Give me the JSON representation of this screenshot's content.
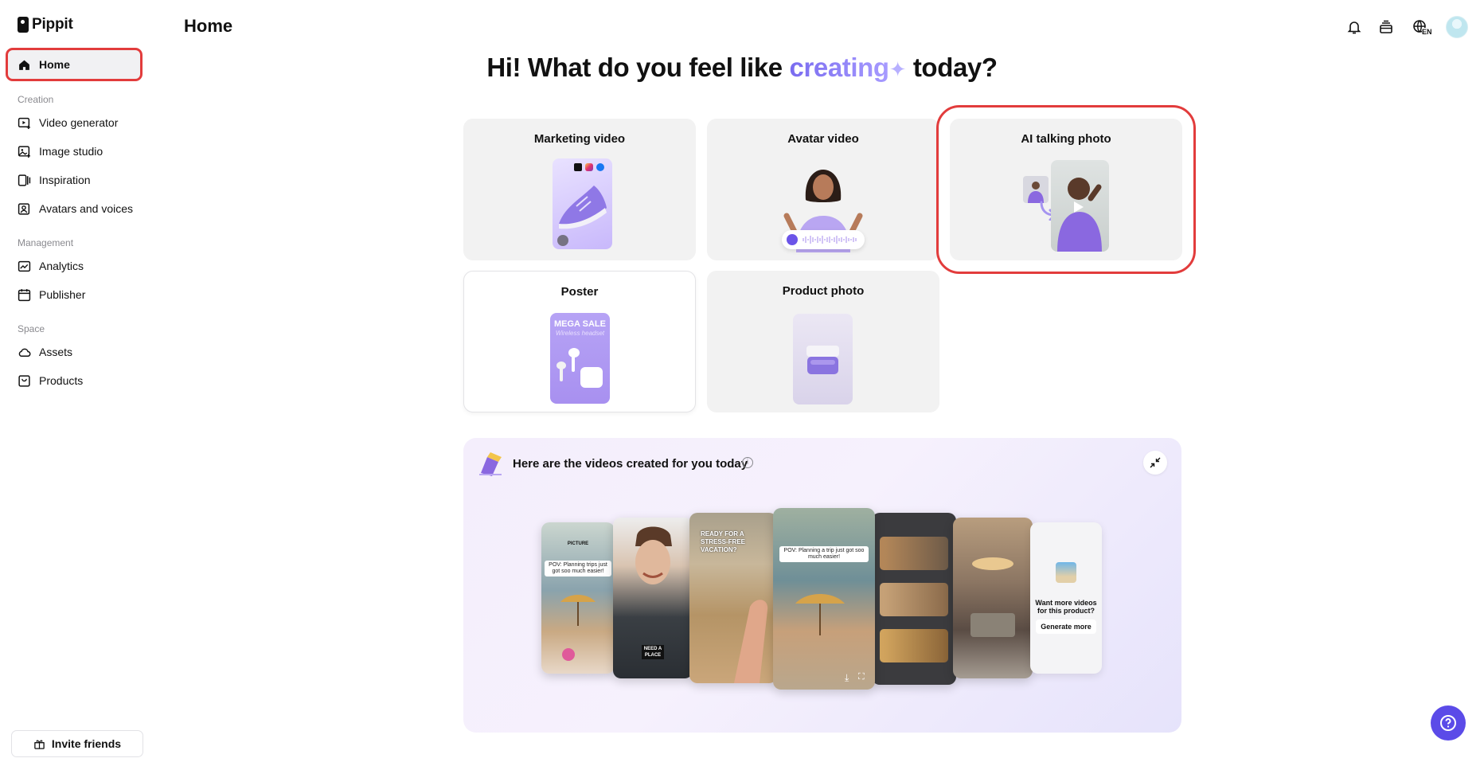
{
  "app": {
    "name": "Pippit"
  },
  "header": {
    "title": "Home",
    "language": "EN"
  },
  "sidebar": {
    "home": "Home",
    "sections": [
      {
        "label": "Creation",
        "items": [
          "Video generator",
          "Image studio",
          "Inspiration",
          "Avatars and voices"
        ]
      },
      {
        "label": "Management",
        "items": [
          "Analytics",
          "Publisher"
        ]
      },
      {
        "label": "Space",
        "items": [
          "Assets",
          "Products"
        ]
      }
    ],
    "invite": "Invite friends"
  },
  "hero": {
    "part1": "Hi! What do you feel like ",
    "highlight": "creating",
    "part2": " today?"
  },
  "cards": [
    {
      "title": "Marketing video"
    },
    {
      "title": "Avatar video"
    },
    {
      "title": "AI talking photo"
    },
    {
      "title": "Poster",
      "thumb_line1": "MEGA SALE",
      "thumb_line2": "Wireless headset"
    },
    {
      "title": "Product photo"
    }
  ],
  "videos_panel": {
    "title": "Here are the videos created for you today",
    "captions": {
      "v1_top": "PICTURE",
      "v1": "POV: Planning trips just got soo much easier!",
      "v2": "NEED A PLACE",
      "v3": "READY FOR A STRESS-FREE VACATION?",
      "v4": "POV: Planning a trip just got soo much easier!"
    },
    "more_prompt": "Want more videos for this product?",
    "generate_label": "Generate more"
  },
  "colors": {
    "accent": "#5b4be8",
    "highlight_border": "#e23c3c",
    "purple_light": "#b9a6f2"
  }
}
